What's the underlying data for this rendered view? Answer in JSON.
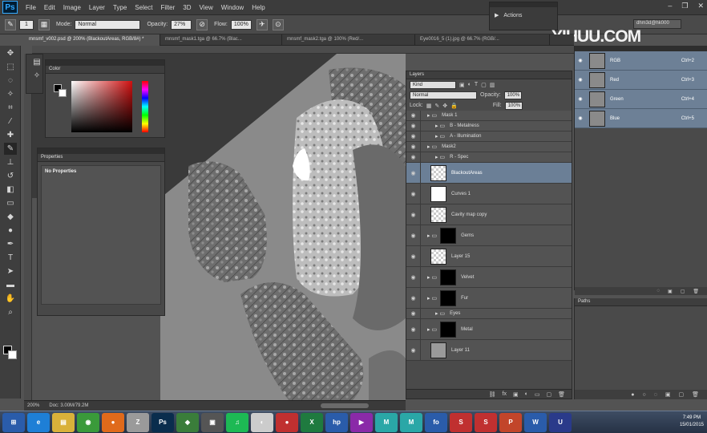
{
  "app": {
    "logo": "Ps",
    "window_controls": [
      "–",
      "❐",
      "✕"
    ]
  },
  "menu": [
    "File",
    "Edit",
    "Image",
    "Layer",
    "Type",
    "Select",
    "Filter",
    "3D",
    "View",
    "Window",
    "Help"
  ],
  "options_bar": {
    "brush_size": "1",
    "mode_label": "Mode:",
    "mode_value": "Normal",
    "opacity_label": "Opacity:",
    "opacity_value": "27%",
    "flow_label": "Flow:",
    "flow_value": "100%"
  },
  "actions_panel": {
    "label": "Actions"
  },
  "workspace": {
    "name": "dhm3d@hk000"
  },
  "watermark": "YIHUU.COM",
  "tabs": [
    {
      "label": "mnsmf_v002.psd @ 200% (BlackoutAreas, RGB/8#) *",
      "active": true
    },
    {
      "label": "mnsmf_mask1.tga @ 66.7% (Blac...",
      "active": false
    },
    {
      "label": "mnsmf_mask2.tga @ 100% (Red/...",
      "active": false
    },
    {
      "label": "Eye0016_5 (1).jpg @ 66.7% (RGB/...",
      "active": false
    }
  ],
  "color_panel": {
    "title": "Color"
  },
  "properties_panel": {
    "title": "Properties",
    "content": "No Properties"
  },
  "layers_panel": {
    "title": "Layers",
    "filter": "Kind",
    "blend_mode": "Normal",
    "opacity_label": "Opacity:",
    "opacity_value": "100%",
    "lock_label": "Lock:",
    "fill_label": "Fill:",
    "fill_value": "100%",
    "footer_icons": [
      "link-icon",
      "fx-icon",
      "mask-icon",
      "adjustment-icon",
      "folder-icon",
      "new-layer-icon",
      "trash-icon"
    ],
    "layers": [
      {
        "name": "Mask 1",
        "type": "group",
        "indent": 0
      },
      {
        "name": "B - Metalness",
        "type": "group",
        "indent": 1
      },
      {
        "name": "A - Illumination",
        "type": "group",
        "indent": 1
      },
      {
        "name": "Mask2",
        "type": "group",
        "indent": 0
      },
      {
        "name": "R - Spec",
        "type": "group",
        "indent": 1
      },
      {
        "name": "BlackoutAreas",
        "type": "layer",
        "thumb": "check",
        "selected": true
      },
      {
        "name": "Curves 1",
        "type": "adjustment",
        "thumb": "white"
      },
      {
        "name": "Cavity map copy",
        "type": "layer",
        "thumb": "check"
      },
      {
        "name": "Gems",
        "type": "group-mask",
        "thumb": "black"
      },
      {
        "name": "Layer 15",
        "type": "layer",
        "thumb": "check"
      },
      {
        "name": "Velvet",
        "type": "group-mask",
        "thumb": "black"
      },
      {
        "name": "Fur",
        "type": "group-mask",
        "thumb": "black"
      },
      {
        "name": "Eyes",
        "type": "group",
        "indent": 1
      },
      {
        "name": "Metal",
        "type": "group-mask",
        "thumb": "black"
      },
      {
        "name": "Layer 11",
        "type": "layer",
        "thumb": "tex"
      }
    ]
  },
  "channels_panel": {
    "channels": [
      {
        "name": "RGB",
        "shortcut": "Ctrl+2"
      },
      {
        "name": "Red",
        "shortcut": "Ctrl+3"
      },
      {
        "name": "Green",
        "shortcut": "Ctrl+4"
      },
      {
        "name": "Blue",
        "shortcut": "Ctrl+5"
      }
    ]
  },
  "paths_panel": {
    "title": "Paths"
  },
  "status": {
    "zoom": "200%",
    "doc": "Doc: 3.00M/79.2M"
  },
  "taskbar": {
    "apps": [
      {
        "name": "ie-icon",
        "label": "e",
        "color": "#1e7fd6"
      },
      {
        "name": "explorer-icon",
        "label": "▤",
        "color": "#d9b13a"
      },
      {
        "name": "chrome-icon",
        "label": "◉",
        "color": "#3a9a3a"
      },
      {
        "name": "firefox-icon",
        "label": "●",
        "color": "#e06a1b"
      },
      {
        "name": "zbrush-icon",
        "label": "Z",
        "color": "#9a9a9a"
      },
      {
        "name": "photoshop-icon",
        "label": "Ps",
        "color": "#0a2d4d"
      },
      {
        "name": "app-icon",
        "label": "◆",
        "color": "#3a7d3a"
      },
      {
        "name": "app-icon-2",
        "label": "▣",
        "color": "#555555"
      },
      {
        "name": "spotify-icon",
        "label": "♫",
        "color": "#1db954"
      },
      {
        "name": "app-icon-3",
        "label": "◐",
        "color": "#cccccc"
      },
      {
        "name": "app-icon-4",
        "label": "●",
        "color": "#c03030"
      },
      {
        "name": "excel-icon",
        "label": "X",
        "color": "#1f7a3f"
      },
      {
        "name": "hp-icon",
        "label": "hp",
        "color": "#2a5caa"
      },
      {
        "name": "app-icon-5",
        "label": "▶",
        "color": "#8a2aa8"
      },
      {
        "name": "maya-icon",
        "label": "M",
        "color": "#2aa7a7"
      },
      {
        "name": "maya-icon-2",
        "label": "M",
        "color": "#2aa7a7"
      },
      {
        "name": "app-icon-6",
        "label": "fo",
        "color": "#2a5caa"
      },
      {
        "name": "app-icon-7",
        "label": "S",
        "color": "#c03030"
      },
      {
        "name": "app-icon-8",
        "label": "S",
        "color": "#c03030"
      },
      {
        "name": "powerpoint-icon",
        "label": "P",
        "color": "#c2452a"
      },
      {
        "name": "word-icon",
        "label": "W",
        "color": "#2a5caa"
      },
      {
        "name": "unreal-icon",
        "label": "U",
        "color": "#2a3a8a"
      }
    ],
    "time": "7:49 PM",
    "date": "15/01/2015"
  }
}
